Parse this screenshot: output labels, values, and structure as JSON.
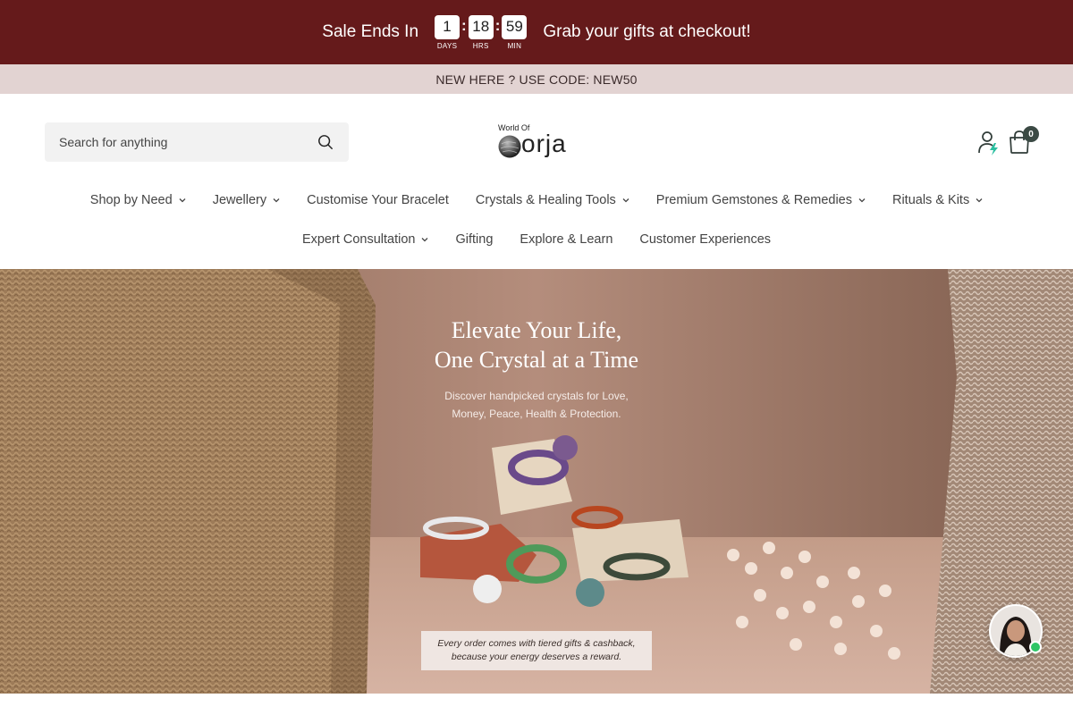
{
  "sale_bar": {
    "left_text": "Sale Ends In",
    "right_text": "Grab your gifts at checkout!",
    "timer": [
      {
        "value": "1",
        "label": "DAYS"
      },
      {
        "value": "18",
        "label": "HRS"
      },
      {
        "value": "59",
        "label": "MIN"
      }
    ],
    "bg_color": "#651a1b"
  },
  "promo_bar": {
    "text": "NEW HERE ? USE CODE: NEW50"
  },
  "header": {
    "search": {
      "placeholder": "Search for anything",
      "icon": "search-icon"
    },
    "logo": {
      "small_text": "World Of",
      "main_text": "orja"
    },
    "account_icon": "account-icon",
    "cart": {
      "icon": "bag-icon",
      "count": "0"
    }
  },
  "nav": {
    "row1": [
      {
        "label": "Shop by Need",
        "dropdown": true
      },
      {
        "label": "Jewellery",
        "dropdown": true
      },
      {
        "label": "Customise Your Bracelet",
        "dropdown": false
      },
      {
        "label": "Crystals & Healing Tools",
        "dropdown": true
      },
      {
        "label": "Premium Gemstones & Remedies",
        "dropdown": true
      },
      {
        "label": "Rituals & Kits",
        "dropdown": true
      }
    ],
    "row2": [
      {
        "label": "Expert Consultation",
        "dropdown": true
      },
      {
        "label": "Gifting",
        "dropdown": false
      },
      {
        "label": "Explore & Learn",
        "dropdown": false
      },
      {
        "label": "Customer Experiences",
        "dropdown": false
      }
    ]
  },
  "hero": {
    "title_line1": "Elevate Your Life,",
    "title_line2": "One Crystal at a Time",
    "subtitle_line1": "Discover handpicked crystals for Love,",
    "subtitle_line2": "Money, Peace, Health & Protection.",
    "note_line1": "Every order comes with tiered gifts & cashback,",
    "note_line2": "because your energy deserves a reward."
  },
  "chat_widget": {
    "status_color": "#2ec566"
  }
}
